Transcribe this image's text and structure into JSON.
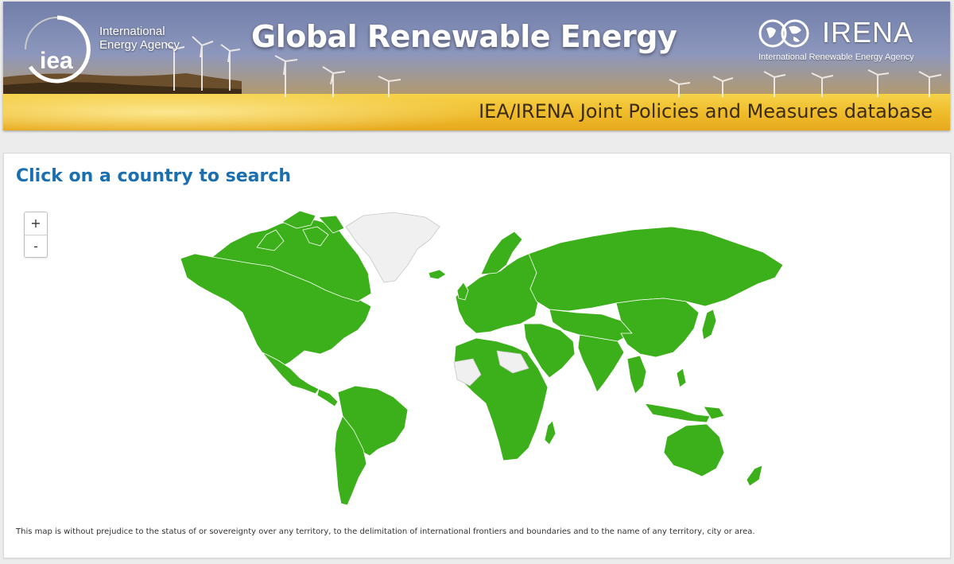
{
  "colors": {
    "member_country": "#3cb01a",
    "non_member_country": "#f0f0f0",
    "country_border": "#ffffff",
    "heading": "#1a6fb0",
    "banner_sky_top": "#7d8ab5",
    "banner_gold": "#f1c131"
  },
  "banner": {
    "iea_logo_text": "iea",
    "iea_name_line1": "International",
    "iea_name_line2": "Energy Agency",
    "title": "Global Renewable Energy",
    "irena_name": "IRENA",
    "irena_full_name": "International Renewable Energy Agency",
    "subtitle": "IEA/IRENA Joint Policies and Measures database"
  },
  "panel": {
    "heading": "Click on a country to search",
    "zoom_in_label": "+",
    "zoom_out_label": "-",
    "disclaimer": "This map is without prejudice to the status of or sovereignty over any territory, to the delimitation of international frontiers and boundaries and to the name of any territory, city or area."
  },
  "icons": {
    "iea_logo": "iea-ring-logo",
    "irena_logo": "irena-globe-logo",
    "zoom_in": "plus-icon",
    "zoom_out": "minus-icon"
  }
}
